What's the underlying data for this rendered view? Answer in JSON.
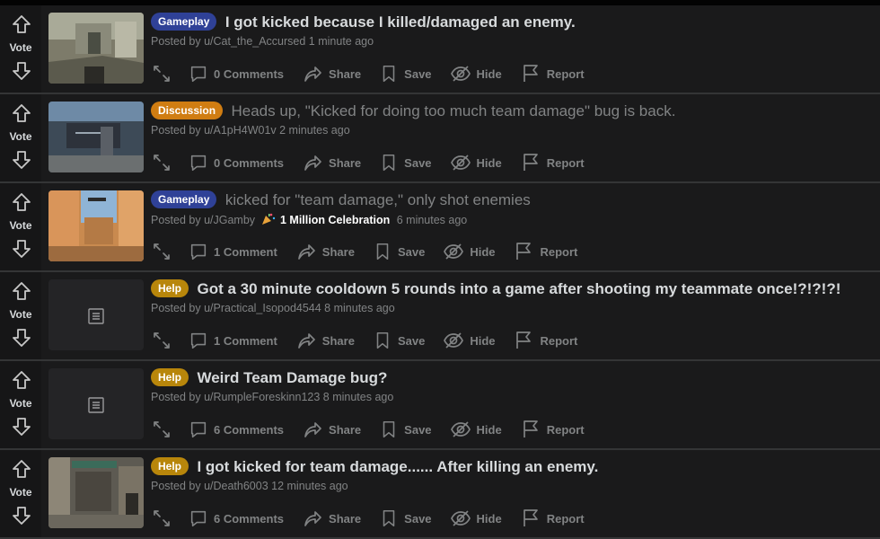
{
  "vote_label": "Vote",
  "actions": {
    "share": "Share",
    "save": "Save",
    "hide": "Hide",
    "report": "Report"
  },
  "icons": [
    "arrow-up-icon",
    "arrow-down-icon",
    "expand-icon",
    "comment-icon",
    "share-icon",
    "save-icon",
    "hide-icon",
    "report-icon",
    "document-icon",
    "party-popper-icon"
  ],
  "colors": {
    "background": "#1a1a1b",
    "flair_gameplay": "#2f4197",
    "flair_discussion": "#d07d12",
    "flair_help": "#b8860b"
  },
  "posts": [
    {
      "flair": "Gameplay",
      "title": "I got kicked because I killed/damaged an enemy.",
      "meta": "Posted by u/Cat_the_Accursed 1 minute ago",
      "comments": "0 Comments"
    },
    {
      "flair": "Discussion",
      "title": "Heads up, \"Kicked for doing too much team damage\" bug is back.",
      "meta": "Posted by u/A1pH4W01v 2 minutes ago",
      "comments": "0 Comments"
    },
    {
      "flair": "Gameplay",
      "title": "kicked for \"team damage,\" only shot enemies",
      "meta": "Posted by u/JGamby",
      "award": "1 Million Celebration",
      "time": "6 minutes ago",
      "comments": "1 Comment"
    },
    {
      "flair": "Help",
      "title": "Got a 30 minute cooldown 5 rounds into a game after shooting my teammate once!?!?!?!",
      "meta": "Posted by u/Practical_Isopod4544 8 minutes ago",
      "comments": "1 Comment"
    },
    {
      "flair": "Help",
      "title": "Weird Team Damage bug?",
      "meta": "Posted by u/RumpleForeskinn123 8 minutes ago",
      "comments": "6 Comments"
    },
    {
      "flair": "Help",
      "title": "I got kicked for team damage...... After killing an enemy.",
      "meta": "Posted by u/Death6003 12 minutes ago",
      "comments": "6 Comments"
    }
  ]
}
